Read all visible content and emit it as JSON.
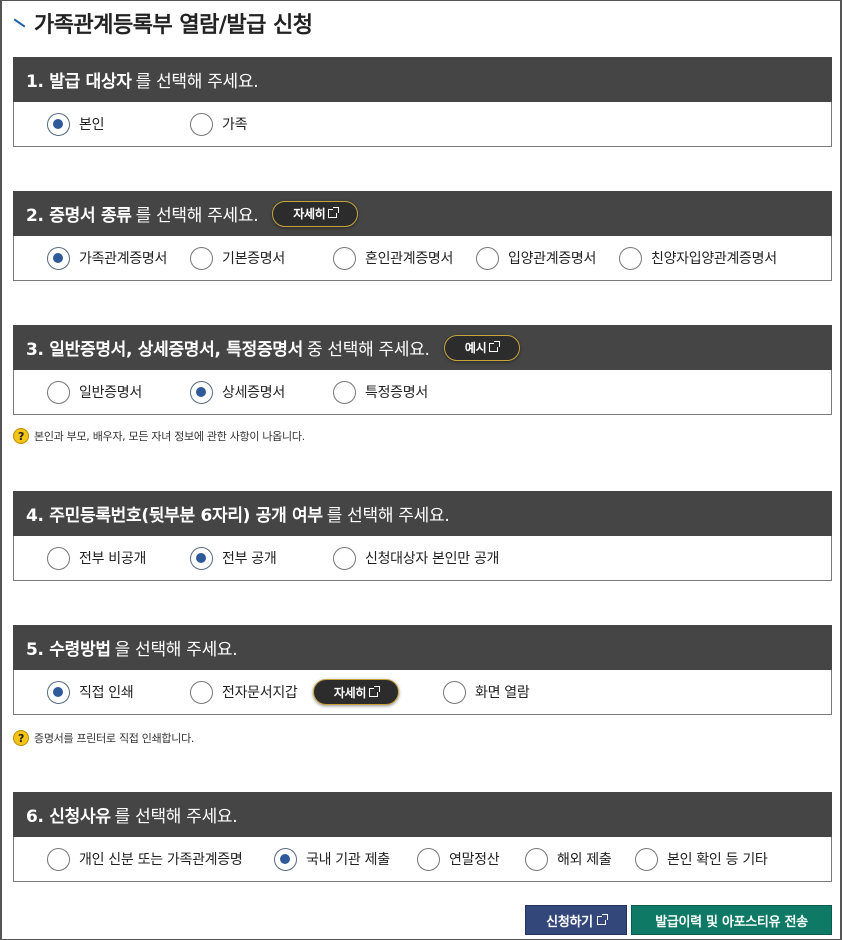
{
  "page": {
    "title": "가족관계등록부 열람/발급 신청"
  },
  "sections": [
    {
      "bold": "1. 발급 대상자",
      "rest": "를 선택해 주세요.",
      "options": [
        {
          "label": "본인",
          "selected": true
        },
        {
          "label": "가족",
          "selected": false
        }
      ]
    },
    {
      "bold": "2. 증명서 종류",
      "rest": "를 선택해 주세요.",
      "pill": "자세히",
      "options": [
        {
          "label": "가족관계증명서",
          "selected": true
        },
        {
          "label": "기본증명서",
          "selected": false
        },
        {
          "label": "혼인관계증명서",
          "selected": false
        },
        {
          "label": "입양관계증명서",
          "selected": false
        },
        {
          "label": "친양자입양관계증명서",
          "selected": false
        }
      ]
    },
    {
      "bold": "3. 일반증명서, 상세증명서, 특정증명서",
      "rest": "중 선택해 주세요.",
      "pill": "예시",
      "options": [
        {
          "label": "일반증명서",
          "selected": false
        },
        {
          "label": "상세증명서",
          "selected": true
        },
        {
          "label": "특정증명서",
          "selected": false
        }
      ],
      "note": "본인과 부모, 배우자, 모든 자녀 정보에 관한 사항이 나옵니다."
    },
    {
      "bold": "4. 주민등록번호(뒷부분 6자리) 공개 여부",
      "rest": "를 선택해 주세요.",
      "options": [
        {
          "label": "전부 비공개",
          "selected": false
        },
        {
          "label": "전부 공개",
          "selected": true
        },
        {
          "label": "신청대상자 본인만 공개",
          "selected": false
        }
      ]
    },
    {
      "bold": "5. 수령방법",
      "rest": "을 선택해 주세요.",
      "inline_pill": "자세히",
      "options": [
        {
          "label": "직접 인쇄",
          "selected": true
        },
        {
          "label": "전자문서지갑",
          "selected": false
        },
        {
          "label": "화면 열람",
          "selected": false
        }
      ],
      "note": "증명서를 프린터로 직접 인쇄합니다."
    },
    {
      "bold": "6. 신청사유",
      "rest": "를 선택해 주세요.",
      "options": [
        {
          "label": "개인 신분 또는 가족관계증명",
          "selected": false
        },
        {
          "label": "국내 기관 제출",
          "selected": true
        },
        {
          "label": "연말정산",
          "selected": false
        },
        {
          "label": "해외 제출",
          "selected": false
        },
        {
          "label": "본인 확인 등 기타",
          "selected": false
        }
      ]
    }
  ],
  "note_icon": "question-icon",
  "buttons": {
    "apply": "신청하기",
    "history": "발급이력 및 아포스티유 전송"
  },
  "colors": {
    "header_bg": "#454545",
    "radio_selected": "#2f5a9a",
    "apply_button": "#33477a",
    "history_button": "#0e7a66",
    "pill_border": "#c8a53b"
  }
}
